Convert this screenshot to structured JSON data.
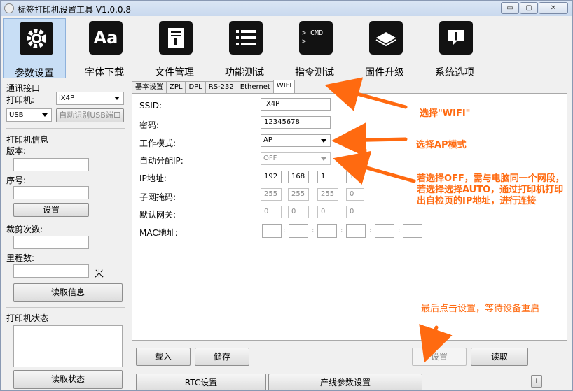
{
  "window": {
    "title": "标签打印机设置工具 V1.0.0.8",
    "min": "▭",
    "max": "▢",
    "close": "✕"
  },
  "toolbar": [
    {
      "label": "参数设置",
      "icon": "gear-icon",
      "glyph": "⚙"
    },
    {
      "label": "字体下载",
      "icon": "font-icon",
      "glyph": "Aa"
    },
    {
      "label": "文件管理",
      "icon": "file-icon",
      "glyph": "▤"
    },
    {
      "label": "功能测试",
      "icon": "list-icon",
      "glyph": "☰"
    },
    {
      "label": "指令测试",
      "icon": "terminal-icon",
      "glyph": "> CMD\n>_"
    },
    {
      "label": "固件升级",
      "icon": "chip-icon",
      "glyph": "◆"
    },
    {
      "label": "系统选项",
      "icon": "alert-icon",
      "glyph": "!"
    }
  ],
  "left": {
    "comm_title": "通讯接口",
    "printer_label": "打印机:",
    "printer_value": "iX4P",
    "port_value": "USB",
    "auto_usb_button": "自动识别USB端口",
    "info_title": "打印机信息",
    "version_label": "版本:",
    "version_value": "",
    "serial_label": "序号:",
    "serial_value": "",
    "set_button": "设置",
    "cut_label": "裁剪次数:",
    "cut_value": "",
    "mileage_label": "里程数:",
    "mileage_value": "",
    "mileage_unit": "米",
    "read_info_button": "读取信息",
    "status_title": "打印机状态",
    "status_value": "",
    "read_status_button": "读取状态"
  },
  "tabs": [
    "基本设置",
    "ZPL",
    "DPL",
    "RS-232",
    "Ethernet",
    "WIFI"
  ],
  "wifi": {
    "ssid_label": "SSID:",
    "ssid_value": "IX4P",
    "pwd_label": "密码:",
    "pwd_value": "12345678",
    "mode_label": "工作模式:",
    "mode_value": "AP",
    "auto_ip_label": "自动分配IP:",
    "auto_ip_value": "OFF",
    "ip_label": "IP地址:",
    "ip": [
      "192",
      "168",
      "1",
      "1"
    ],
    "mask_label": "子网掩码:",
    "mask": [
      "255",
      "255",
      "255",
      "0"
    ],
    "gw_label": "默认网关:",
    "gw": [
      "0",
      "0",
      "0",
      "0"
    ],
    "mac_label": "MAC地址:",
    "mac": [
      "",
      "",
      "",
      "",
      "",
      ""
    ],
    "mac_sep": ":"
  },
  "annotations": {
    "select_wifi": "选择\"WIFI\"",
    "select_ap": "选择AP模式",
    "off_auto_note": "若选择OFF，需与电脑同一个网段，若选择选择AUTO，通过打印机打印出自检页的IP地址，进行连接",
    "final_note": "最后点击设置，等待设备重启",
    "color": "#ff6a10"
  },
  "bottom": {
    "load_button": "载入",
    "save_button": "储存",
    "set_button": "设置",
    "read_button": "读取",
    "rtc_button": "RTC设置",
    "line_param_button": "产线参数设置",
    "plus_button": "+"
  }
}
